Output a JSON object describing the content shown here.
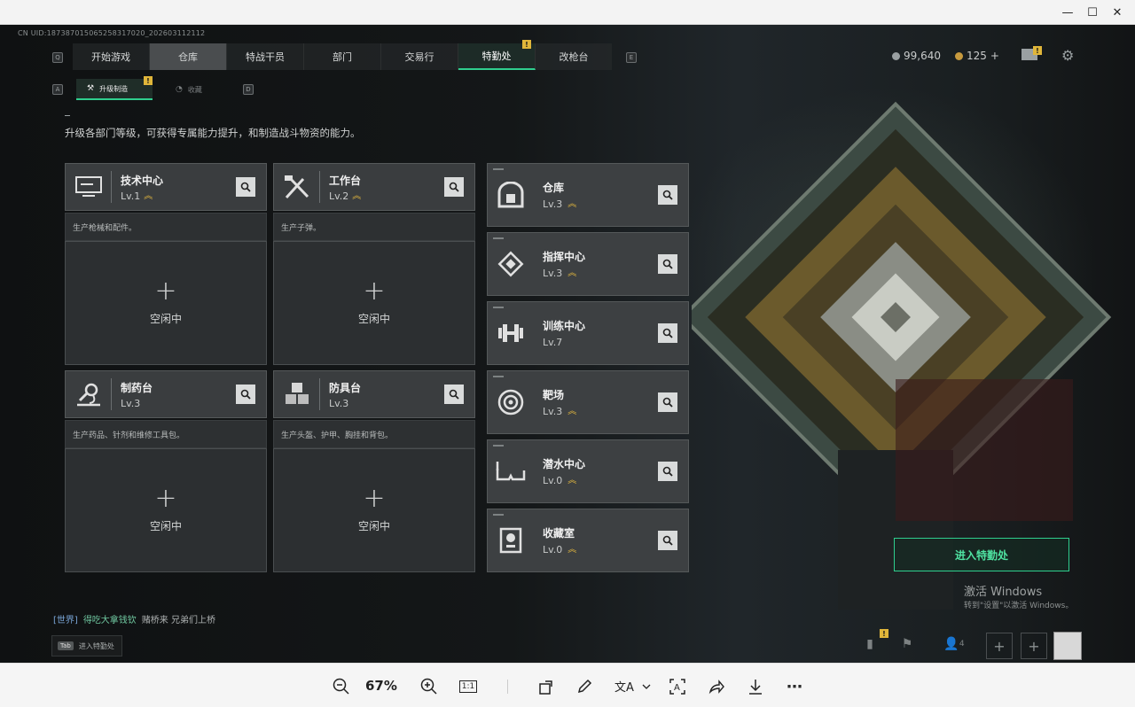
{
  "window": {
    "minimize": "—",
    "maximize": "☐",
    "close": "✕"
  },
  "uid": "CN UID:1873870150652583170​20_202603112112",
  "tabs": [
    {
      "label": "开始游戏",
      "state": ""
    },
    {
      "label": "仓库",
      "state": "grey"
    },
    {
      "label": "特战干员",
      "state": ""
    },
    {
      "label": "部门",
      "state": ""
    },
    {
      "label": "交易行",
      "state": ""
    },
    {
      "label": "特勤处",
      "state": "green"
    },
    {
      "label": "改枪台",
      "state": ""
    }
  ],
  "key_hints": {
    "q": "Q",
    "e": "E",
    "a": "A",
    "d": "D"
  },
  "alert_mark": "!",
  "currency": {
    "silver": "99,640",
    "gold": "125",
    "gold_add": "+"
  },
  "subtabs": {
    "upgrade": "升级制造",
    "collection": "收藏"
  },
  "description": "升级各部门等级，可获得专属能力提升，和制造战斗物资的能力。",
  "lvup_glyph": "︽",
  "left_cards": [
    {
      "name": "技术中心",
      "level": "Lv.1",
      "up": true,
      "desc": "生产枪械和配件。",
      "idle": "空闲中",
      "icon": "computer-icon"
    },
    {
      "name": "工作台",
      "level": "Lv.2",
      "up": true,
      "desc": "生产子弹。",
      "idle": "空闲中",
      "icon": "tools-icon"
    },
    {
      "name": "制药台",
      "level": "Lv.3",
      "up": false,
      "desc": "生产药品、针剂和维修工具包。",
      "idle": "空闲中",
      "icon": "microscope-icon"
    },
    {
      "name": "防具台",
      "level": "Lv.3",
      "up": false,
      "desc": "生产头盔、护甲、胸挂和背包。",
      "idle": "空闲中",
      "icon": "cubes-icon"
    }
  ],
  "plus": "+",
  "right_cards": [
    {
      "name": "仓库",
      "level": "Lv.3",
      "up": true,
      "icon": "vault-icon"
    },
    {
      "name": "指挥中心",
      "level": "Lv.3",
      "up": true,
      "icon": "chip-icon"
    },
    {
      "name": "训练中心",
      "level": "Lv.7",
      "up": false,
      "icon": "dumbbell-icon"
    },
    {
      "name": "靶场",
      "level": "Lv.3",
      "up": true,
      "icon": "target-icon"
    },
    {
      "name": "潜水中心",
      "level": "Lv.0",
      "up": true,
      "icon": "goggles-icon"
    },
    {
      "name": "收藏室",
      "level": "Lv.0",
      "up": true,
      "icon": "trophy-icon"
    }
  ],
  "enter_button": "进入特勤处",
  "watermark": {
    "line1": "激活 Windows",
    "line2": "转到\"设置\"以激活 Windows。"
  },
  "chat": {
    "channel": "[世界]",
    "user": "得吃大拿钱钦",
    "message": "赌桥来  兄弟们上桥"
  },
  "tab_hint": {
    "key": "Tab",
    "label": "进入特勤处"
  },
  "bottom_bar": {
    "friends_count": "4",
    "plus": "+"
  },
  "viewer": {
    "zoom": "67%",
    "actual_size": "1:1"
  }
}
